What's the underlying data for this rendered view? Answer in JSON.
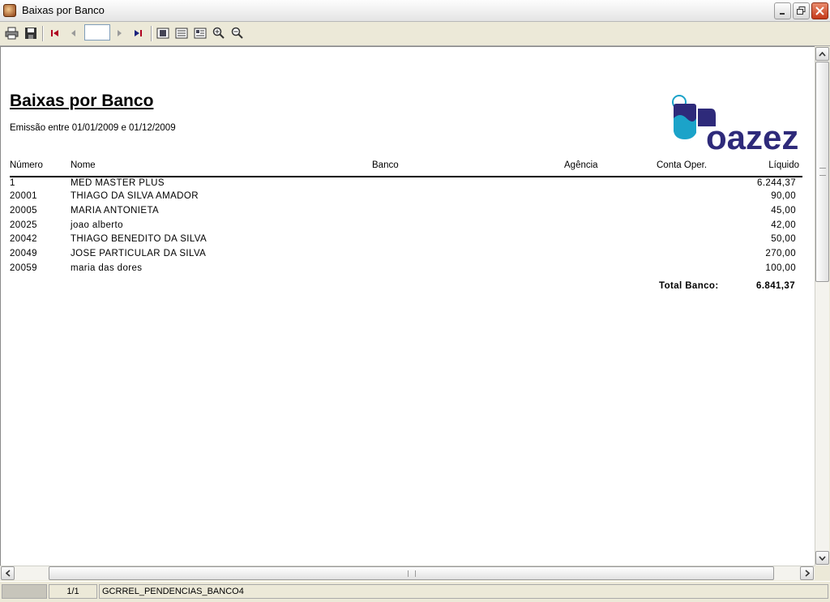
{
  "window": {
    "title": "Baixas por Banco"
  },
  "toolbar": {
    "page_input_value": "",
    "buttons": [
      "printer-icon",
      "save-icon",
      "first-page-icon",
      "previous-page-icon",
      "next-page-icon",
      "last-page-icon",
      "page-width-icon",
      "two-pages-icon",
      "whole-page-icon",
      "zoom-in-icon",
      "zoom-out-icon"
    ]
  },
  "report": {
    "title": "Baixas por Banco",
    "subtitle": "Emissão entre 01/01/2009 e 01/12/2009",
    "logo_text": "oazez",
    "columns": {
      "numero": "Número",
      "nome": "Nome",
      "banco": "Banco",
      "agencia": "Agência",
      "conta": "Conta Oper.",
      "liquido": "Líquido"
    },
    "rows": [
      {
        "numero": "1",
        "nome": "MED MASTER PLUS",
        "liquido": "6.244,37"
      },
      {
        "numero": "20001",
        "nome": "THIAGO DA SILVA AMADOR",
        "liquido": "90,00"
      },
      {
        "numero": "20005",
        "nome": "MARIA ANTONIETA",
        "liquido": "45,00"
      },
      {
        "numero": "20025",
        "nome": "joao alberto",
        "liquido": "42,00"
      },
      {
        "numero": "20042",
        "nome": "THIAGO BENEDITO DA SILVA",
        "liquido": "50,00"
      },
      {
        "numero": "20049",
        "nome": "JOSE PARTICULAR DA SILVA",
        "liquido": "270,00"
      },
      {
        "numero": "20059",
        "nome": "maria das dores",
        "liquido": "100,00"
      }
    ],
    "total_label": "Total Banco:",
    "total_value": "6.841,37"
  },
  "statusbar": {
    "cell1": "",
    "page": "1/1",
    "report_name": "GCRREL_PENDENCIAS_BANCO4"
  },
  "colors": {
    "logo_navy": "#2E2A7A",
    "logo_cyan": "#1BA3C9",
    "close_button": "#C4391A"
  }
}
